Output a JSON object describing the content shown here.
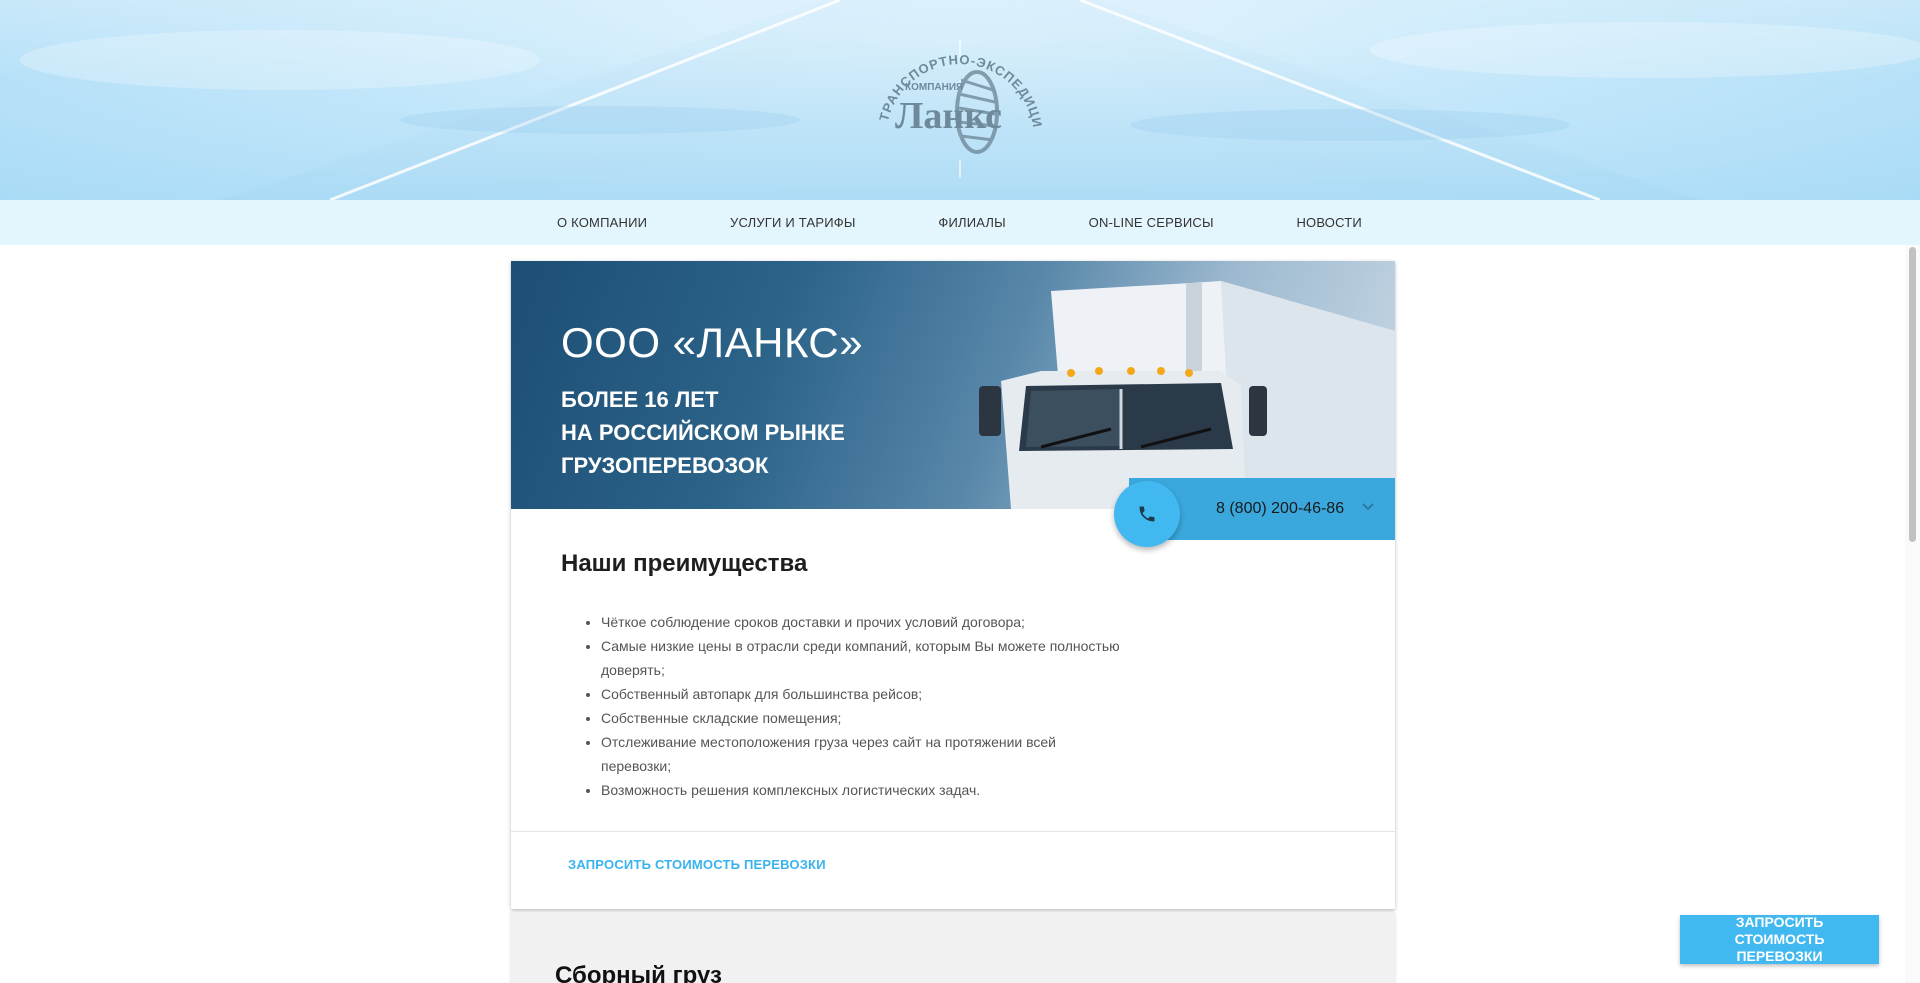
{
  "header": {
    "logo": {
      "arc_text": "ТРАНСПОРТНО-ЭКСПЕДИЦИОННАЯ",
      "small_text": "КОМПАНИЯ",
      "brand": "Ланкс"
    }
  },
  "nav": {
    "items": [
      {
        "label": "О КОМПАНИИ"
      },
      {
        "label": "УСЛУГИ И ТАРИФЫ"
      },
      {
        "label": "ФИЛИАЛЫ"
      },
      {
        "label": "ON-LINE СЕРВИСЫ"
      },
      {
        "label": "НОВОСТИ"
      }
    ]
  },
  "hero": {
    "title": "ООО «ЛАНКС»",
    "subtitle_lines": [
      "БОЛЕЕ 16 ЛЕТ",
      "НА РОССИЙСКОМ РЫНКЕ",
      "ГРУЗОПЕРЕВОЗОК"
    ]
  },
  "phone": {
    "number": "8 (800) 200-46-86",
    "icon": "phone-icon"
  },
  "advantages": {
    "title": "Наши преимущества",
    "items": [
      "Чёткое соблюдение сроков доставки и прочих условий договора;",
      "Самые низкие цены в отрасли среди компаний, которым Вы можете полностью доверять;",
      "Собственный автопарк для большинства рейсов;",
      "Собственные складские помещения;",
      "Отслеживание местоположения груза через сайт на протяжении всей перевозки;",
      "Возможность решения комплексных логистических задач."
    ],
    "action_label": "ЗАПРОСИТЬ СТОИМОСТЬ ПЕРЕВОЗКИ"
  },
  "next_card": {
    "title": "Сборный груз"
  },
  "floating_button": {
    "label": "ЗАПРОСИТЬ СТОИМОСТЬ ПЕРЕВОЗКИ"
  },
  "colors": {
    "accent": "#41b8f0",
    "phone_bar": "#3aa8dd",
    "header_sky": "#c9e9fb"
  }
}
